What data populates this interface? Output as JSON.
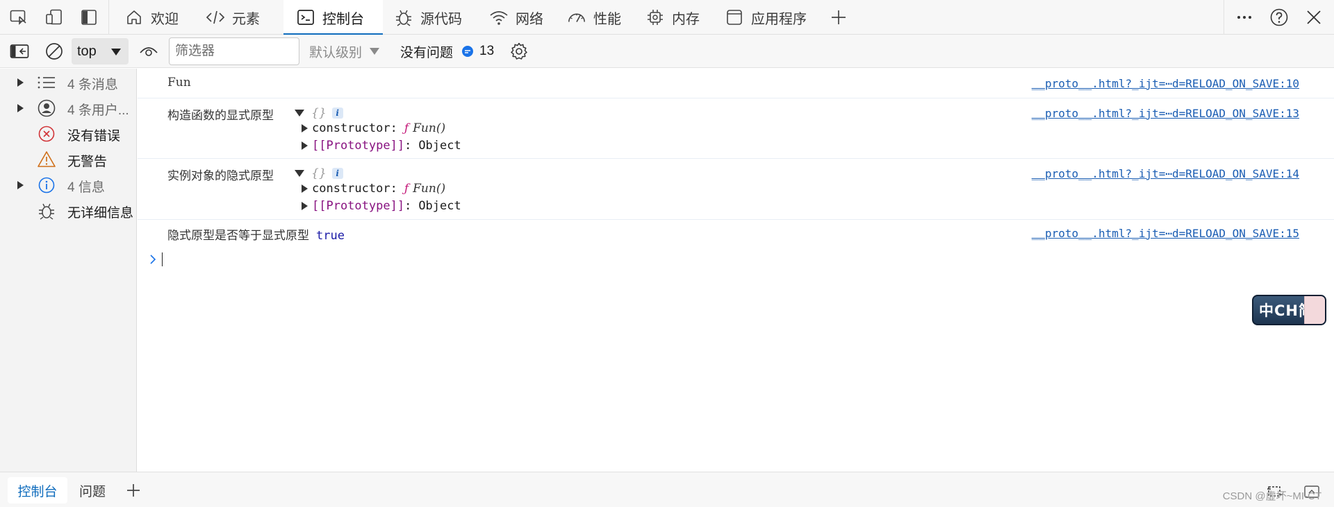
{
  "tabs": [
    {
      "label": "欢迎",
      "icon": "home-icon"
    },
    {
      "label": "元素",
      "icon": "code-icon"
    },
    {
      "label": "控制台",
      "icon": "console-icon",
      "active": true
    },
    {
      "label": "源代码",
      "icon": "bug-icon"
    },
    {
      "label": "网络",
      "icon": "wifi-icon"
    },
    {
      "label": "性能",
      "icon": "gauge-icon"
    },
    {
      "label": "内存",
      "icon": "chip-icon"
    },
    {
      "label": "应用程序",
      "icon": "window-icon"
    }
  ],
  "toolbar": {
    "context_value": "top",
    "filter_placeholder": "筛选器",
    "levels_label": "默认级别",
    "issues_label": "没有问题",
    "issues_count": "13"
  },
  "sidebar": {
    "items": [
      {
        "label": "4 条消息",
        "icon": "list-icon",
        "expandable": true
      },
      {
        "label": "4 条用户...",
        "icon": "user-icon",
        "expandable": true
      },
      {
        "label": "没有错误",
        "icon": "error-icon",
        "expandable": false
      },
      {
        "label": "无警告",
        "icon": "warning-icon",
        "expandable": false
      },
      {
        "label": "4 信息",
        "icon": "info-icon",
        "expandable": true
      },
      {
        "label": "无详细信息",
        "icon": "verbose-bug-icon",
        "expandable": false
      }
    ]
  },
  "console": {
    "messages": [
      {
        "text": "Fun",
        "source": "__proto__.html?_ijt=⋯d=RELOAD_ON_SAVE:10"
      },
      {
        "text": "构造函数的显式原型",
        "object": "{}",
        "source": "__proto__.html?_ijt=⋯d=RELOAD_ON_SAVE:13",
        "props": [
          {
            "key": "constructor",
            "fn_kw": "ƒ",
            "value": "Fun()"
          },
          {
            "key": "[[Prototype]]",
            "value": "Object"
          }
        ]
      },
      {
        "text": "实例对象的隐式原型",
        "object": "{}",
        "source": "__proto__.html?_ijt=⋯d=RELOAD_ON_SAVE:14",
        "props": [
          {
            "key": "constructor",
            "fn_kw": "ƒ",
            "value": "Fun()"
          },
          {
            "key": "[[Prototype]]",
            "value": "Object"
          }
        ]
      },
      {
        "text": "隐式原型是否等于显式原型",
        "value": "true",
        "source": "__proto__.html?_ijt=⋯d=RELOAD_ON_SAVE:15"
      }
    ],
    "info_badge": "i",
    "colon": ":"
  },
  "ime_badge": "中CH简",
  "bottom_tabs": [
    {
      "label": "控制台",
      "active": true
    },
    {
      "label": "问题",
      "active": false
    }
  ],
  "watermark": "CSDN @虚坏~MI-CT",
  "colors": {
    "accent": "#0f6cbd",
    "link": "#1a5db3",
    "keyword": "#c41a79",
    "boolean": "#1a1aa6"
  }
}
